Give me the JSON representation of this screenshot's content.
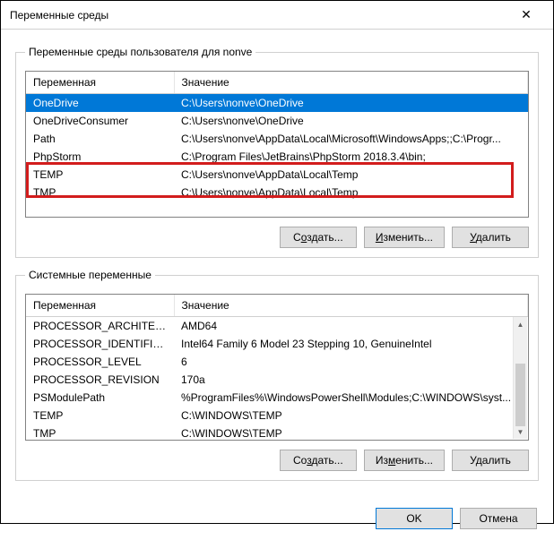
{
  "window": {
    "title": "Переменные среды",
    "close_glyph": "✕"
  },
  "user_group": {
    "legend": "Переменные среды пользователя для nonve",
    "col_var": "Переменная",
    "col_val": "Значение",
    "rows": [
      {
        "name": "OneDrive",
        "value": "C:\\Users\\nonve\\OneDrive"
      },
      {
        "name": "OneDriveConsumer",
        "value": "C:\\Users\\nonve\\OneDrive"
      },
      {
        "name": "Path",
        "value": "C:\\Users\\nonve\\AppData\\Local\\Microsoft\\WindowsApps;;C:\\Progr..."
      },
      {
        "name": "PhpStorm",
        "value": "C:\\Program Files\\JetBrains\\PhpStorm 2018.3.4\\bin;"
      },
      {
        "name": "TEMP",
        "value": "C:\\Users\\nonve\\AppData\\Local\\Temp"
      },
      {
        "name": "TMP",
        "value": "C:\\Users\\nonve\\AppData\\Local\\Temp"
      }
    ],
    "buttons": {
      "new_pre": "С",
      "new_u": "о",
      "new_post": "здать...",
      "edit_pre": "",
      "edit_u": "И",
      "edit_post": "зменить...",
      "del_pre": "",
      "del_u": "У",
      "del_post": "далить"
    }
  },
  "sys_group": {
    "legend": "Системные переменные",
    "col_var": "Переменная",
    "col_val": "Значение",
    "rows": [
      {
        "name": "PROCESSOR_ARCHITECTURE",
        "value": "AMD64"
      },
      {
        "name": "PROCESSOR_IDENTIFIER",
        "value": "Intel64 Family 6 Model 23 Stepping 10, GenuineIntel"
      },
      {
        "name": "PROCESSOR_LEVEL",
        "value": "6"
      },
      {
        "name": "PROCESSOR_REVISION",
        "value": "170a"
      },
      {
        "name": "PSModulePath",
        "value": "%ProgramFiles%\\WindowsPowerShell\\Modules;C:\\WINDOWS\\syst..."
      },
      {
        "name": "TEMP",
        "value": "C:\\WINDOWS\\TEMP"
      },
      {
        "name": "TMP",
        "value": "C:\\WINDOWS\\TEMP"
      }
    ],
    "buttons": {
      "new_pre": "Со",
      "new_u": "з",
      "new_post": "дать...",
      "edit_pre": "Из",
      "edit_u": "м",
      "edit_post": "енить...",
      "del_pre": "У",
      "del_u": "д",
      "del_post": "алить"
    }
  },
  "footer": {
    "ok": "OK",
    "cancel": "Отмена"
  }
}
